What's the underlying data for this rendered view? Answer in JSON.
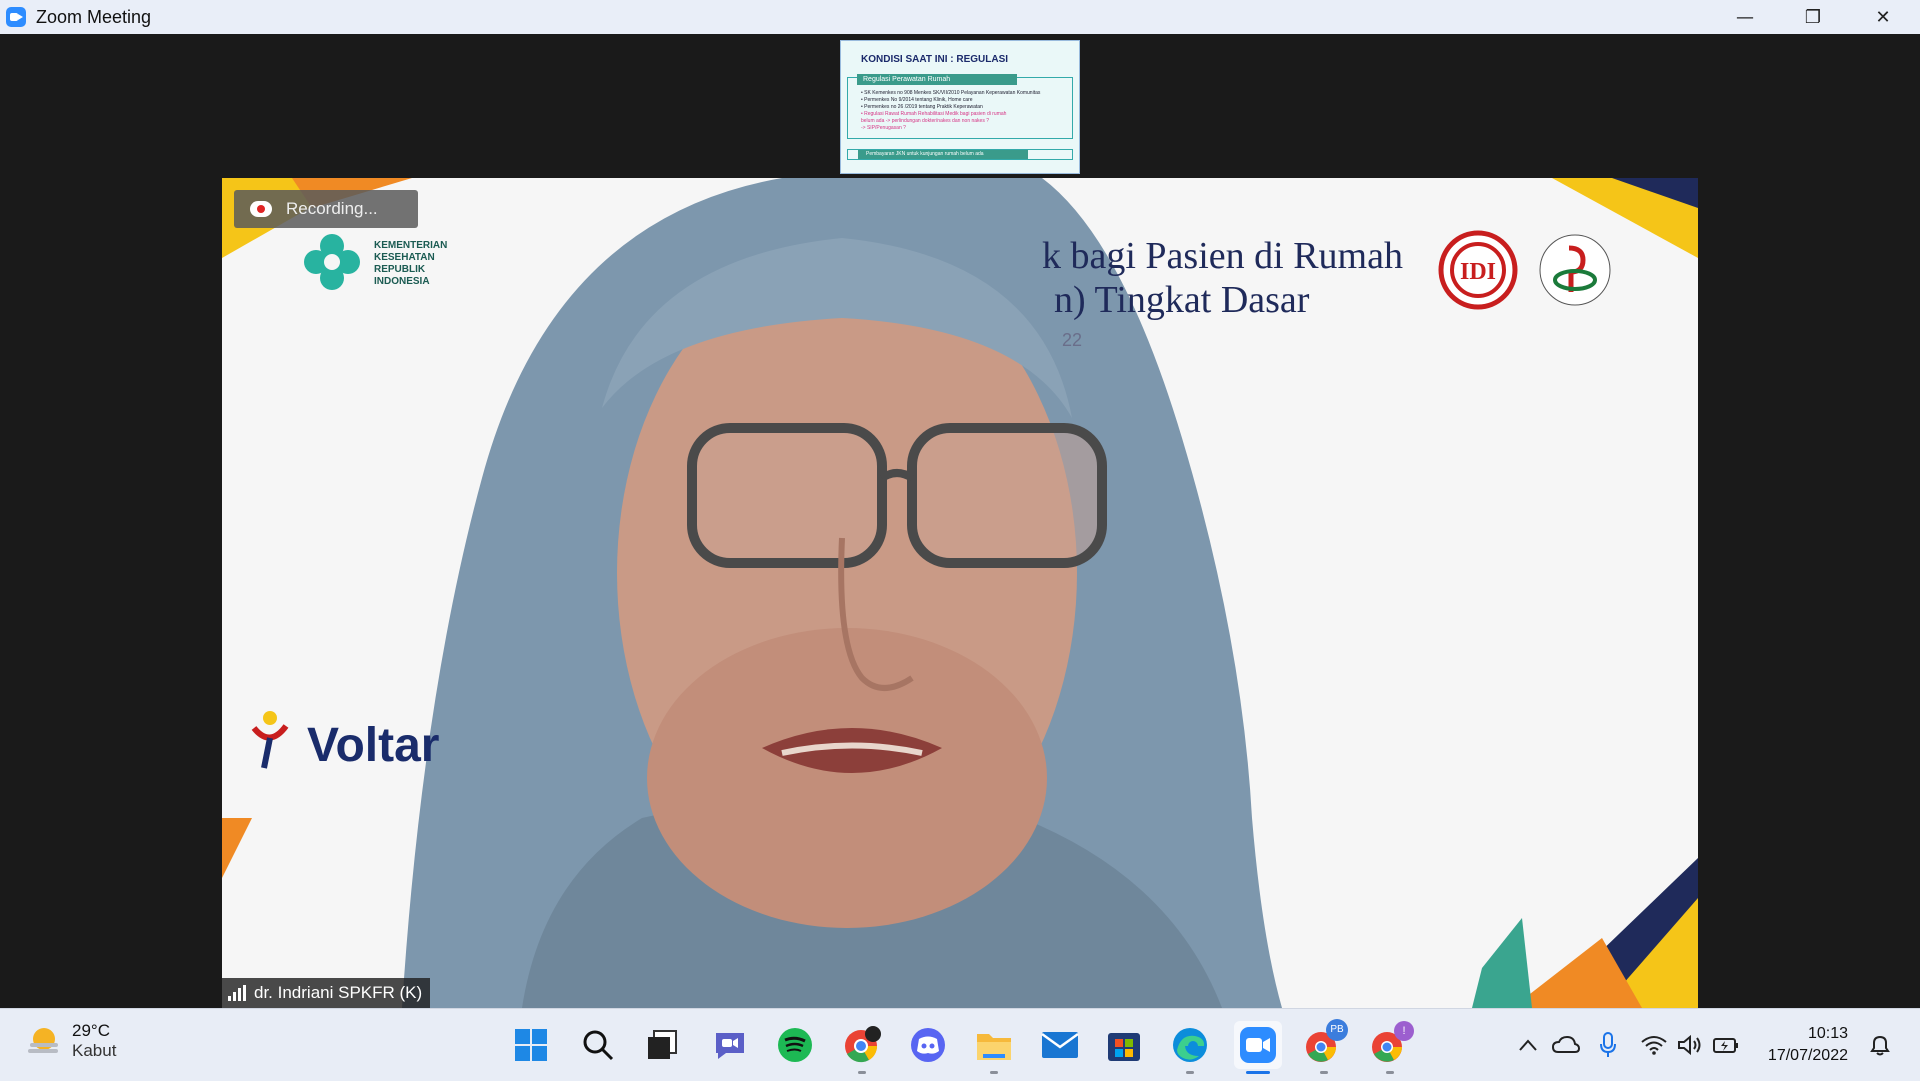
{
  "window": {
    "title": "Zoom Meeting",
    "controls": {
      "minimize": "—",
      "restore": "❐",
      "close": "✕"
    }
  },
  "shared_screen": {
    "title": "KONDISI SAAT INI : REGULASI",
    "box_heading": "Regulasi Perawatan Rumah",
    "lines": [
      "• SK Kemenkes no 908 Menkes SK/VII/2010 Pelayanan Keperawatan Komunitas",
      "• Permenkes No 9/2014 tentang Klinik, Home care",
      "• Permenkes no 26 /2019 tentang Praktik Keperawatan"
    ],
    "pink_lines": [
      "• Regulasi Rawat Rumah Rehabilitasi Medik bagi pasien di rumah",
      "   belum ada -> perlindungan dokter/nakes dan non nakes ?",
      "   -> SIP/Penugasan ?"
    ],
    "footer": "Pembayaran JKN untuk kunjungan rumah belum ada"
  },
  "video": {
    "recording_label": "Recording...",
    "participant_name": "dr. Indriani SPKFR (K)",
    "banner": {
      "title_line1": "k bagi Pasien di Rumah",
      "title_line2": "n) Tingkat Dasar",
      "sub": "22",
      "kemenkes": "KEMENTERIAN\nKESEHATAN\nREPUBLIK\nINDONESIA",
      "voltaren": "Voltar",
      "idi_logo": "IDI"
    }
  },
  "taskbar": {
    "weather_temp": "29°C",
    "weather_desc": "Kabut",
    "badges": {
      "chrome_pb": "PB",
      "chrome_notif": "!"
    },
    "clock_time": "10:13",
    "clock_date": "17/07/2022"
  },
  "colors": {
    "zoom_blue": "#2d8cff",
    "banner_navy": "#1f2a5a",
    "banner_yellow": "#f5c518",
    "banner_orange": "#f08a24",
    "teal": "#3a9b8b"
  }
}
